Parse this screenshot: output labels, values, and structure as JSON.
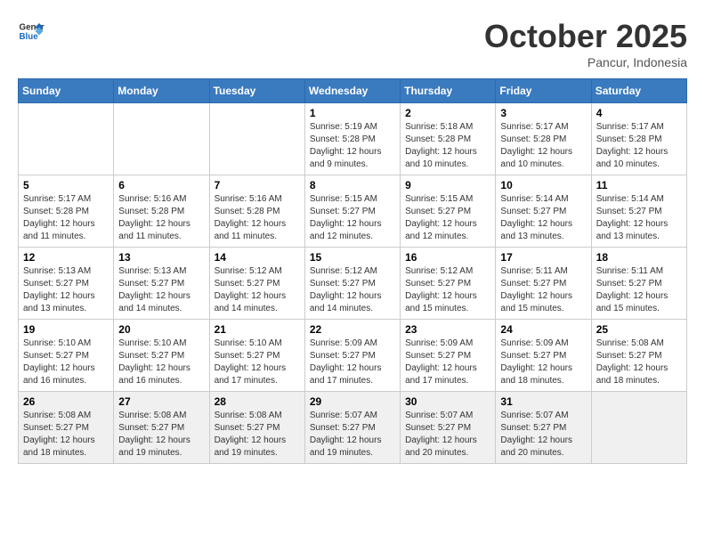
{
  "header": {
    "logo_line1": "General",
    "logo_line2": "Blue",
    "month": "October 2025",
    "location": "Pancur, Indonesia"
  },
  "weekdays": [
    "Sunday",
    "Monday",
    "Tuesday",
    "Wednesday",
    "Thursday",
    "Friday",
    "Saturday"
  ],
  "weeks": [
    [
      {
        "day": "",
        "info": ""
      },
      {
        "day": "",
        "info": ""
      },
      {
        "day": "",
        "info": ""
      },
      {
        "day": "1",
        "info": "Sunrise: 5:19 AM\nSunset: 5:28 PM\nDaylight: 12 hours\nand 9 minutes."
      },
      {
        "day": "2",
        "info": "Sunrise: 5:18 AM\nSunset: 5:28 PM\nDaylight: 12 hours\nand 10 minutes."
      },
      {
        "day": "3",
        "info": "Sunrise: 5:17 AM\nSunset: 5:28 PM\nDaylight: 12 hours\nand 10 minutes."
      },
      {
        "day": "4",
        "info": "Sunrise: 5:17 AM\nSunset: 5:28 PM\nDaylight: 12 hours\nand 10 minutes."
      }
    ],
    [
      {
        "day": "5",
        "info": "Sunrise: 5:17 AM\nSunset: 5:28 PM\nDaylight: 12 hours\nand 11 minutes."
      },
      {
        "day": "6",
        "info": "Sunrise: 5:16 AM\nSunset: 5:28 PM\nDaylight: 12 hours\nand 11 minutes."
      },
      {
        "day": "7",
        "info": "Sunrise: 5:16 AM\nSunset: 5:28 PM\nDaylight: 12 hours\nand 11 minutes."
      },
      {
        "day": "8",
        "info": "Sunrise: 5:15 AM\nSunset: 5:27 PM\nDaylight: 12 hours\nand 12 minutes."
      },
      {
        "day": "9",
        "info": "Sunrise: 5:15 AM\nSunset: 5:27 PM\nDaylight: 12 hours\nand 12 minutes."
      },
      {
        "day": "10",
        "info": "Sunrise: 5:14 AM\nSunset: 5:27 PM\nDaylight: 12 hours\nand 13 minutes."
      },
      {
        "day": "11",
        "info": "Sunrise: 5:14 AM\nSunset: 5:27 PM\nDaylight: 12 hours\nand 13 minutes."
      }
    ],
    [
      {
        "day": "12",
        "info": "Sunrise: 5:13 AM\nSunset: 5:27 PM\nDaylight: 12 hours\nand 13 minutes."
      },
      {
        "day": "13",
        "info": "Sunrise: 5:13 AM\nSunset: 5:27 PM\nDaylight: 12 hours\nand 14 minutes."
      },
      {
        "day": "14",
        "info": "Sunrise: 5:12 AM\nSunset: 5:27 PM\nDaylight: 12 hours\nand 14 minutes."
      },
      {
        "day": "15",
        "info": "Sunrise: 5:12 AM\nSunset: 5:27 PM\nDaylight: 12 hours\nand 14 minutes."
      },
      {
        "day": "16",
        "info": "Sunrise: 5:12 AM\nSunset: 5:27 PM\nDaylight: 12 hours\nand 15 minutes."
      },
      {
        "day": "17",
        "info": "Sunrise: 5:11 AM\nSunset: 5:27 PM\nDaylight: 12 hours\nand 15 minutes."
      },
      {
        "day": "18",
        "info": "Sunrise: 5:11 AM\nSunset: 5:27 PM\nDaylight: 12 hours\nand 15 minutes."
      }
    ],
    [
      {
        "day": "19",
        "info": "Sunrise: 5:10 AM\nSunset: 5:27 PM\nDaylight: 12 hours\nand 16 minutes."
      },
      {
        "day": "20",
        "info": "Sunrise: 5:10 AM\nSunset: 5:27 PM\nDaylight: 12 hours\nand 16 minutes."
      },
      {
        "day": "21",
        "info": "Sunrise: 5:10 AM\nSunset: 5:27 PM\nDaylight: 12 hours\nand 17 minutes."
      },
      {
        "day": "22",
        "info": "Sunrise: 5:09 AM\nSunset: 5:27 PM\nDaylight: 12 hours\nand 17 minutes."
      },
      {
        "day": "23",
        "info": "Sunrise: 5:09 AM\nSunset: 5:27 PM\nDaylight: 12 hours\nand 17 minutes."
      },
      {
        "day": "24",
        "info": "Sunrise: 5:09 AM\nSunset: 5:27 PM\nDaylight: 12 hours\nand 18 minutes."
      },
      {
        "day": "25",
        "info": "Sunrise: 5:08 AM\nSunset: 5:27 PM\nDaylight: 12 hours\nand 18 minutes."
      }
    ],
    [
      {
        "day": "26",
        "info": "Sunrise: 5:08 AM\nSunset: 5:27 PM\nDaylight: 12 hours\nand 18 minutes."
      },
      {
        "day": "27",
        "info": "Sunrise: 5:08 AM\nSunset: 5:27 PM\nDaylight: 12 hours\nand 19 minutes."
      },
      {
        "day": "28",
        "info": "Sunrise: 5:08 AM\nSunset: 5:27 PM\nDaylight: 12 hours\nand 19 minutes."
      },
      {
        "day": "29",
        "info": "Sunrise: 5:07 AM\nSunset: 5:27 PM\nDaylight: 12 hours\nand 19 minutes."
      },
      {
        "day": "30",
        "info": "Sunrise: 5:07 AM\nSunset: 5:27 PM\nDaylight: 12 hours\nand 20 minutes."
      },
      {
        "day": "31",
        "info": "Sunrise: 5:07 AM\nSunset: 5:27 PM\nDaylight: 12 hours\nand 20 minutes."
      },
      {
        "day": "",
        "info": ""
      }
    ]
  ]
}
